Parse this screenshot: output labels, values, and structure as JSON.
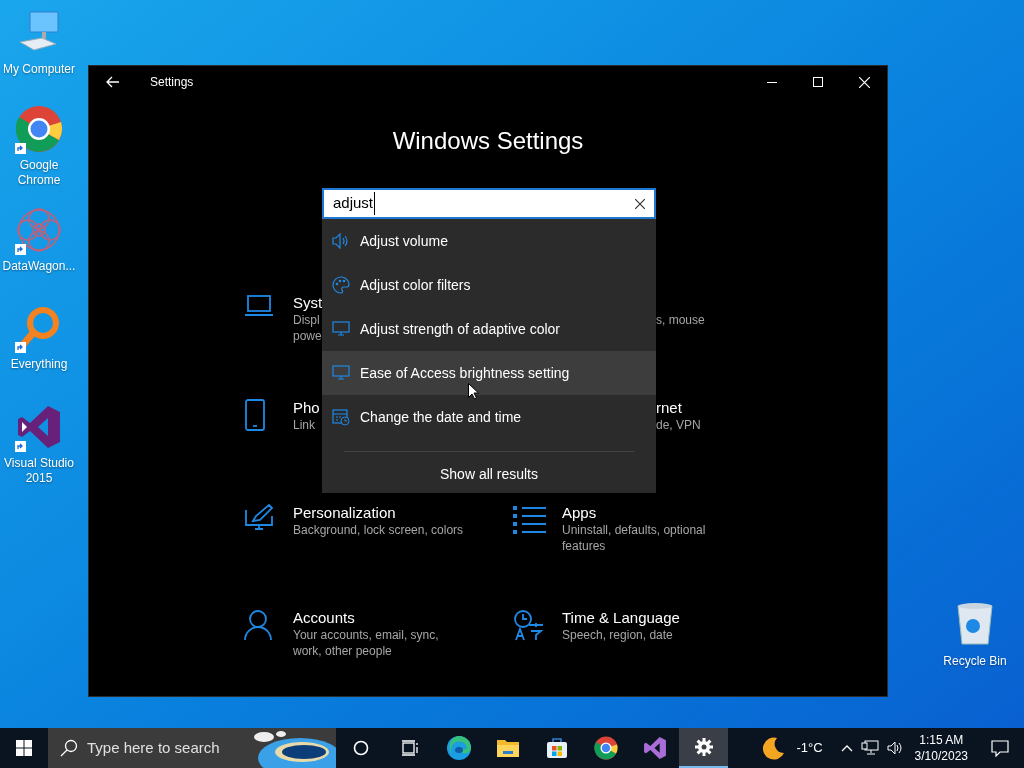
{
  "desktop_icons": [
    {
      "kind": "computer",
      "label": "My Computer",
      "shortcut": false
    },
    {
      "kind": "chrome",
      "label": "Google Chrome",
      "shortcut": true
    },
    {
      "kind": "datawagon",
      "label": "DataWagon...",
      "shortcut": true
    },
    {
      "kind": "everything",
      "label": "Everything",
      "shortcut": true
    },
    {
      "kind": "vs",
      "label": "Visual Studio 2015",
      "shortcut": true
    }
  ],
  "recycle_bin": {
    "label": "Recycle Bin"
  },
  "window": {
    "title": "Settings",
    "heading": "Windows Settings"
  },
  "search": {
    "value": "adjust"
  },
  "suggestions": [
    {
      "kind": "volume",
      "label": "Adjust volume",
      "hovered": false
    },
    {
      "kind": "palette",
      "label": "Adjust color filters",
      "hovered": false
    },
    {
      "kind": "monitor",
      "label": "Adjust strength of adaptive color",
      "hovered": false
    },
    {
      "kind": "monitor",
      "label": "Ease of Access brightness setting",
      "hovered": true
    },
    {
      "kind": "calendar",
      "label": "Change the date and time",
      "hovered": false
    }
  ],
  "show_all": "Show all results",
  "tiles": [
    {
      "kind": "laptop",
      "title": "Syst",
      "lines": [
        "Displ",
        "powe"
      ]
    },
    {
      "kind": "hidden",
      "lines": [
        "s, mouse"
      ]
    },
    {
      "kind": "phone",
      "title": "Pho",
      "lines": [
        "Link"
      ]
    },
    {
      "kind": "hidden",
      "title": "rnet",
      "lines": [
        "de, VPN"
      ]
    },
    {
      "kind": "brush",
      "title": "Personalization",
      "lines": [
        "Background, lock screen, colors"
      ]
    },
    {
      "kind": "apps",
      "title": "Apps",
      "lines": [
        "Uninstall, defaults, optional",
        "features"
      ]
    },
    {
      "kind": "person",
      "title": "Accounts",
      "lines": [
        "Your accounts, email, sync,",
        "work, other people"
      ]
    },
    {
      "kind": "clock",
      "title": "Time & Language",
      "lines": [
        "Speech, region, date"
      ]
    }
  ],
  "taskbar": {
    "search_placeholder": "Type here to search",
    "apps": [
      {
        "kind": "cortana",
        "active": false
      },
      {
        "kind": "taskview",
        "active": false
      },
      {
        "kind": "edge",
        "active": false
      },
      {
        "kind": "folder",
        "active": false
      },
      {
        "kind": "store",
        "active": false
      },
      {
        "kind": "chrome",
        "active": false
      },
      {
        "kind": "vs",
        "active": false
      },
      {
        "kind": "gear",
        "active": true
      }
    ],
    "temperature": "-1°C",
    "time": "1:15 AM",
    "date": "3/10/2023"
  }
}
